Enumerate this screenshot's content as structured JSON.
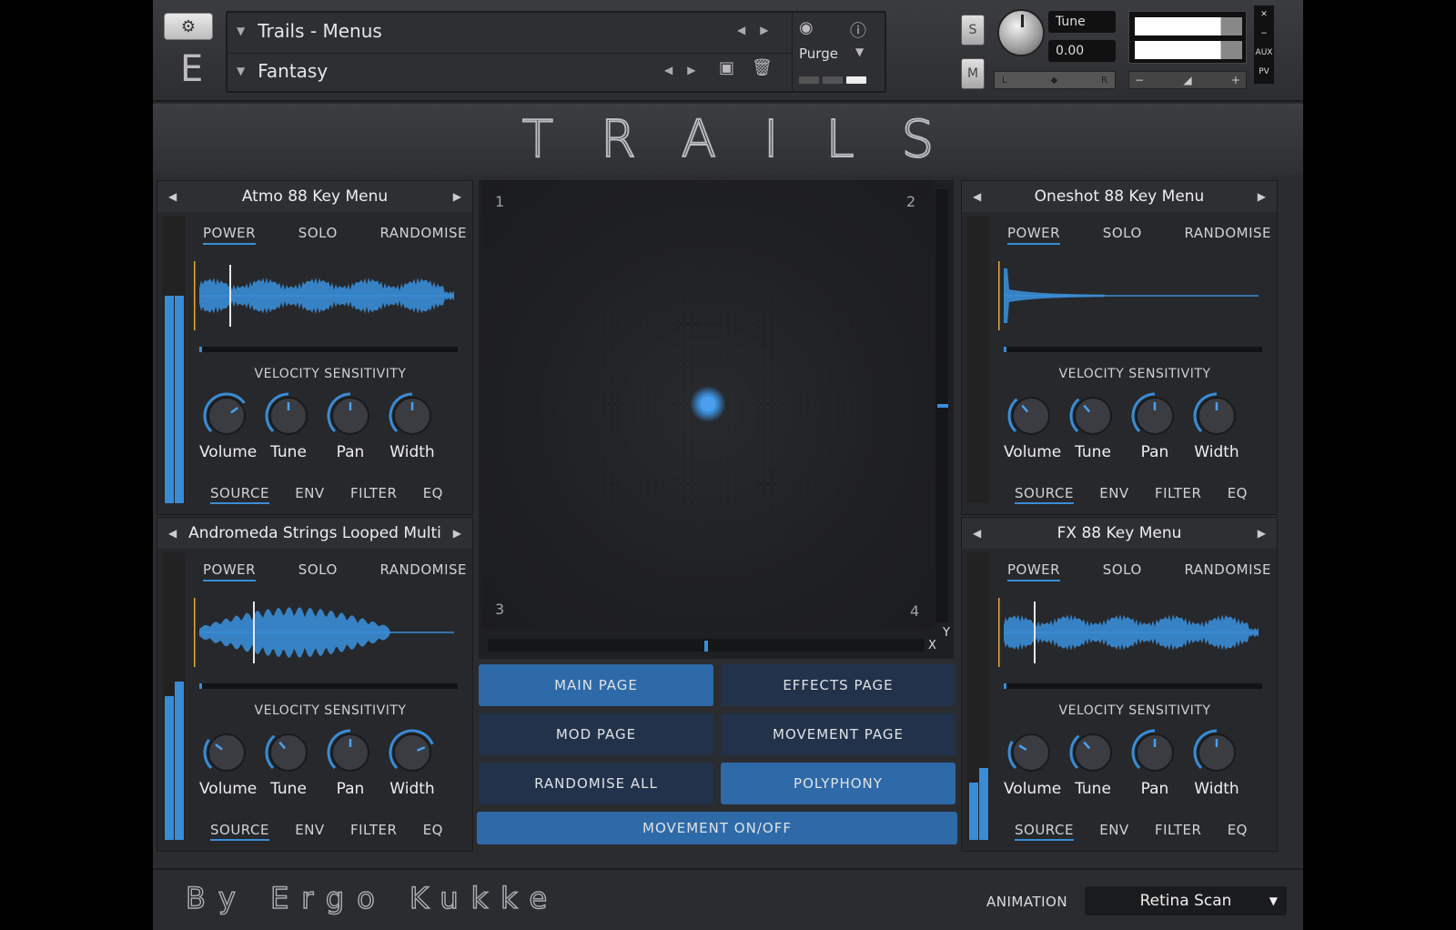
{
  "header": {
    "preset_title": "Trails - Menus",
    "preset_sub": "Fantasy",
    "purge_label": "Purge",
    "tune_label": "Tune",
    "tune_value": "0.00",
    "solo_btn": "S",
    "mute_btn": "M",
    "pan_left": "L",
    "pan_right": "R",
    "vol_minus": "−",
    "vol_plus": "+",
    "side": {
      "close": "✕",
      "minimize": "−",
      "aux": "AUX",
      "pv": "PV"
    },
    "logo_letter": "E"
  },
  "title": "TRAILS",
  "slots": [
    {
      "name": "Atmo 88 Key Menu",
      "tabs_top": [
        "POWER",
        "SOLO",
        "RANDOMISE"
      ],
      "velocity_label": "VELOCITY SENSITIVITY",
      "knobs": [
        {
          "label": "Volume",
          "value": 0.7
        },
        {
          "label": "Tune",
          "value": 0.5
        },
        {
          "label": "Pan",
          "value": 0.5
        },
        {
          "label": "Width",
          "value": 0.5
        }
      ],
      "tabs_bottom": [
        "SOURCE",
        "ENV",
        "FILTER",
        "EQ"
      ],
      "meter": [
        0.72,
        0.72
      ],
      "wave": "dense"
    },
    {
      "name": "Oneshot 88 Key Menu",
      "tabs_top": [
        "POWER",
        "SOLO",
        "RANDOMISE"
      ],
      "velocity_label": "VELOCITY SENSITIVITY",
      "knobs": [
        {
          "label": "Volume",
          "value": 0.35
        },
        {
          "label": "Tune",
          "value": 0.35
        },
        {
          "label": "Pan",
          "value": 0.5
        },
        {
          "label": "Width",
          "value": 0.5
        }
      ],
      "tabs_bottom": [
        "SOURCE",
        "ENV",
        "FILTER",
        "EQ"
      ],
      "meter": [
        0,
        0
      ],
      "wave": "oneshot"
    },
    {
      "name": "Andromeda Strings Looped Multi",
      "tabs_top": [
        "POWER",
        "SOLO",
        "RANDOMISE"
      ],
      "velocity_label": "VELOCITY SENSITIVITY",
      "knobs": [
        {
          "label": "Volume",
          "value": 0.3
        },
        {
          "label": "Tune",
          "value": 0.35
        },
        {
          "label": "Pan",
          "value": 0.5
        },
        {
          "label": "Width",
          "value": 0.75
        }
      ],
      "tabs_bottom": [
        "SOURCE",
        "ENV",
        "FILTER",
        "EQ"
      ],
      "meter": [
        0.5,
        0.55
      ],
      "wave": "swell"
    },
    {
      "name": "FX 88 Key Menu",
      "tabs_top": [
        "POWER",
        "SOLO",
        "RANDOMISE"
      ],
      "velocity_label": "VELOCITY SENSITIVITY",
      "knobs": [
        {
          "label": "Volume",
          "value": 0.28
        },
        {
          "label": "Tune",
          "value": 0.35
        },
        {
          "label": "Pan",
          "value": 0.5
        },
        {
          "label": "Width",
          "value": 0.5
        }
      ],
      "tabs_bottom": [
        "SOURCE",
        "ENV",
        "FILTER",
        "EQ"
      ],
      "meter": [
        0.2,
        0.25
      ],
      "wave": "dense"
    }
  ],
  "xy": {
    "corners": [
      "1",
      "2",
      "3",
      "4"
    ],
    "x_label": "X",
    "y_label": "Y",
    "x_value": 0.5,
    "y_value": 0.5
  },
  "buttons": [
    {
      "label": "MAIN PAGE",
      "active": true
    },
    {
      "label": "EFFECTS PAGE",
      "active": false
    },
    {
      "label": "MOD PAGE",
      "active": false
    },
    {
      "label": "MOVEMENT PAGE",
      "active": false
    },
    {
      "label": "RANDOMISE ALL",
      "active": false
    },
    {
      "label": "POLYPHONY",
      "active": true
    },
    {
      "label": "MOVEMENT ON/OFF",
      "active": true
    }
  ],
  "footer": {
    "author": "By Ergo Kukke",
    "animation_label": "ANIMATION",
    "animation_value": "Retina Scan"
  },
  "colors": {
    "accent": "#3a8cd6",
    "playhead_start": "#e8a83a",
    "background": "#2a2c30"
  }
}
